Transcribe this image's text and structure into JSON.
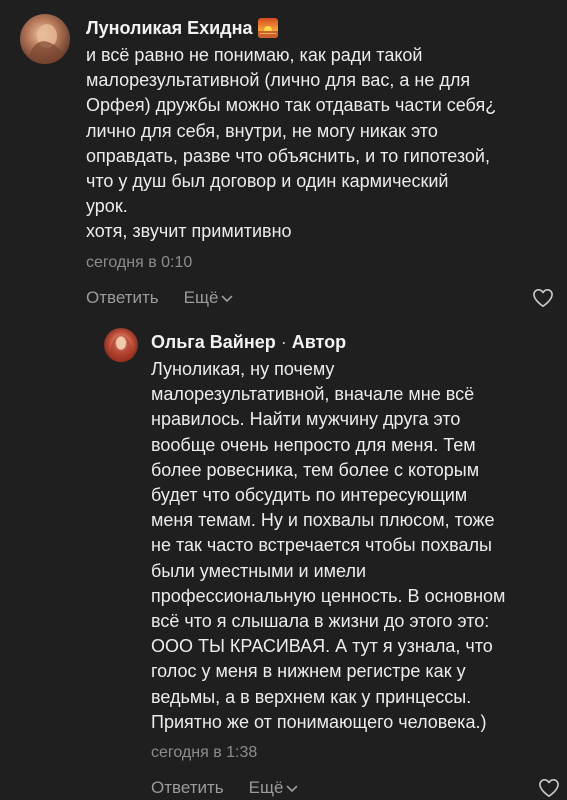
{
  "comment": {
    "author": "Луноликая Ехидна",
    "text_lines": [
      "и всё равно не понимаю, как ради такой",
      "малорезультативной (лично для вас, а не для",
      "Орфея) дружбы можно так отдавать части себя¿",
      "лично для себя, внутри, не могу никак это",
      "оправдать, разве что объяснить, и то гипотезой,",
      "что у душ был договор и один кармический",
      "урок.",
      "хотя, звучит примитивно"
    ],
    "timestamp": "сегодня в 0:10",
    "reply_label": "Ответить",
    "more_label": "Ещё"
  },
  "reply": {
    "author": "Ольга Вайнер",
    "separator": "·",
    "author_badge": "Автор",
    "text_lines": [
      "Луноликая, ну почему",
      "малорезультативной, вначале мне всё",
      "нравилось. Найти мужчину друга это",
      "вообще очень непросто для меня. Тем",
      "более ровесника, тем более с которым",
      "будет что обсудить по интересующим",
      "меня темам. Ну и похвалы плюсом, тоже",
      "не так часто встречается чтобы похвалы",
      "были уместными и имели",
      "профессиональную ценность. В основном",
      "всё что я слышала в жизни до этого это:",
      "ООО ТЫ КРАСИВАЯ. А тут я узнала, что",
      "голос у меня в нижнем регистре как у",
      "ведьмы, а в верхнем как у принцессы.",
      "Приятно же от понимающего человека.)"
    ],
    "timestamp": "сегодня в 1:38",
    "reply_label": "Ответить",
    "more_label": "Ещё"
  },
  "icons": {
    "avatar_1": "avatar-photo",
    "avatar_2": "avatar-photo",
    "author_emoji": "sunset-emoji",
    "more_chevron": "chevron-down-icon",
    "like": "heart-icon"
  }
}
